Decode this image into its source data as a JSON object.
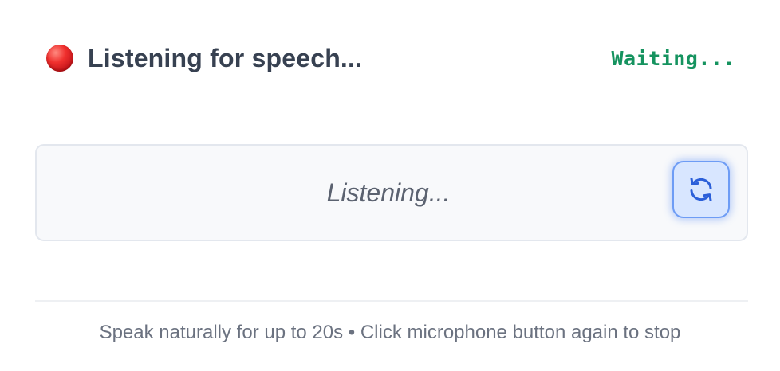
{
  "header": {
    "title": "Listening for speech...",
    "status": "Waiting...",
    "recording_indicator_icon": "red-circle-icon"
  },
  "transcript": {
    "placeholder_text": "Listening...",
    "refresh_button_icon": "refresh-icon"
  },
  "footer": {
    "hint": "Speak naturally for up to 20s • Click microphone button again to stop"
  },
  "colors": {
    "title": "#374151",
    "status": "#15935f",
    "recording_dot": "#e0201f",
    "transcript_background": "#f8f9fb",
    "transcript_border": "#e3e7ee",
    "refresh_button_background": "#d8e6ff",
    "refresh_button_border": "#6d9cf5",
    "refresh_icon": "#2b5fd9",
    "hint": "#6b7280"
  }
}
